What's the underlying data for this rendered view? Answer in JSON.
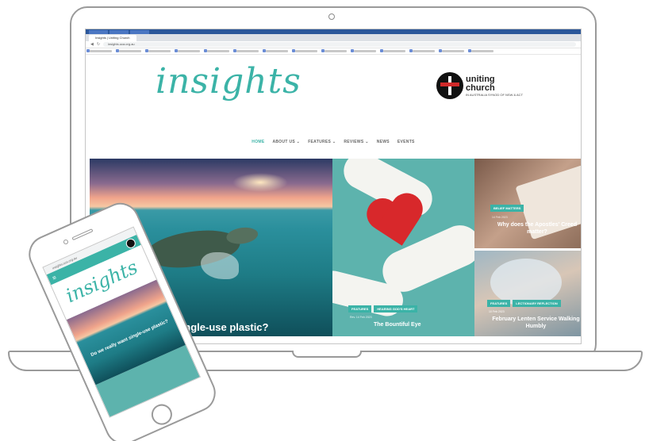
{
  "browser": {
    "tab_title": "Insights | Uniting Church",
    "url": "insights.uca.org.au"
  },
  "site": {
    "logo": "insights",
    "org_name_line1": "uniting",
    "org_name_line2": "church",
    "org_subtitle": "in Australia Synod of NSW & ACT"
  },
  "nav": {
    "items": [
      "HOME",
      "ABOUT US ⌄",
      "FEATURES ⌄",
      "REVIEWS ⌄",
      "NEWS",
      "EVENTS"
    ]
  },
  "hero": {
    "title": "I want single-use plastic?"
  },
  "middle_card": {
    "tag1": "FEATURES",
    "tag2": "HEARING GOD'S HEART",
    "meta": "Rev. 14 Feb 2023",
    "title": "The Bountiful Eye"
  },
  "right_top_card": {
    "tag": "BELIEF MATTERS",
    "meta": "14 Feb 2023",
    "title": "Why does the Apostles' Creed matter?"
  },
  "right_bottom_card": {
    "tag1": "FEATURES",
    "tag2": "LECTIONARY REFLECTION",
    "meta": "10 Feb 2023",
    "title": "February Lenten Service Walking Humbly"
  },
  "phone": {
    "url": "insights.uca.org.au",
    "logo": "insights",
    "hero_title": "Do we really want single-use plastic?"
  },
  "colors": {
    "accent": "#3bb3a7",
    "heart": "#d8282b",
    "device_outline": "#9a9a9a"
  }
}
